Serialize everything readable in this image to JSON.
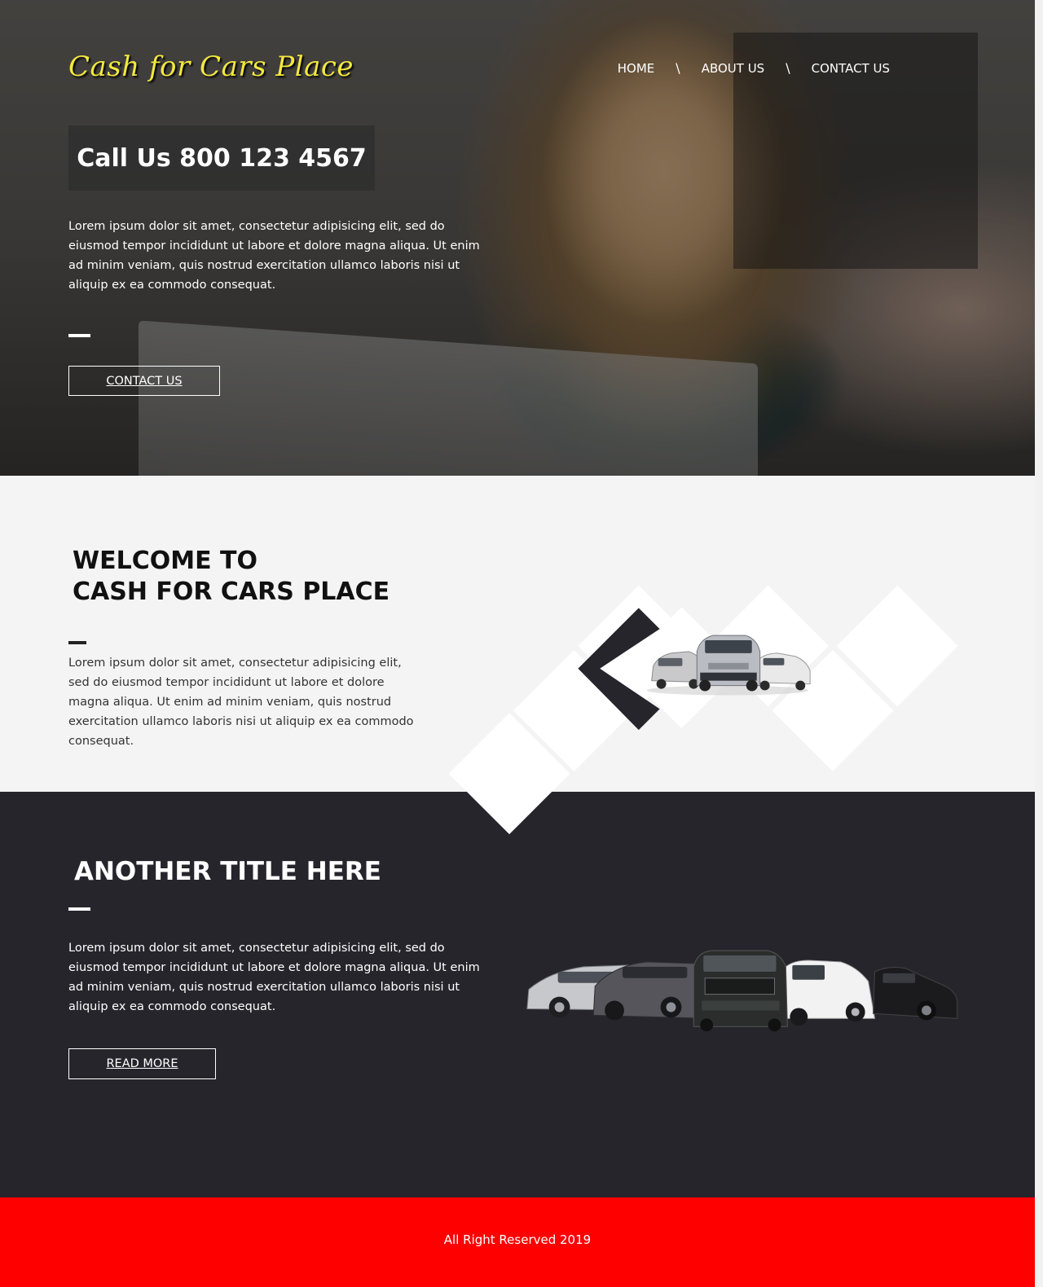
{
  "header": {
    "logo_text": "Cash for Cars Place",
    "nav": [
      "HOME",
      "ABOUT US",
      "CONTACT US"
    ],
    "separator": "\\"
  },
  "hero": {
    "call_text": "Call Us 800 123 4567",
    "text": "Lorem ipsum dolor sit amet, consectetur adipisicing elit, sed do eiusmod tempor incididunt ut labore et dolore magna aliqua. Ut enim ad minim veniam, quis nostrud exercitation ullamco laboris nisi ut aliquip ex ea commodo consequat.",
    "button_label": "CONTACT US"
  },
  "welcome": {
    "title_line1": "WELCOME TO",
    "title_line2": "CASH FOR CARS PLACE",
    "text": "Lorem ipsum dolor sit amet, consectetur adipisicing elit, sed do eiusmod tempor incididunt ut labore et dolore magna aliqua. Ut enim ad minim veniam, quis nostrud exercitation ullamco laboris nisi ut aliquip ex ea commodo consequat."
  },
  "section2": {
    "title": "ANOTHER TITLE HERE",
    "text": "Lorem ipsum dolor sit amet, consectetur adipisicing elit, sed do eiusmod tempor incididunt ut labore et dolore magna aliqua. Ut enim ad minim veniam, quis nostrud exercitation ullamco laboris nisi ut aliquip ex ea commodo consequat.",
    "button_label": "READ MORE"
  },
  "footer": {
    "text": "All Right Reserved 2019"
  },
  "colors": {
    "logo": "#f3e93d",
    "dark_bg": "#26252c",
    "footer_bg": "#ff0000",
    "light_bg": "#f4f4f4"
  }
}
